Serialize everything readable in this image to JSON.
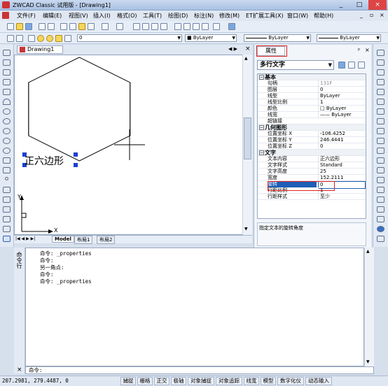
{
  "window": {
    "title": "ZWCAD Classic 试用版 - [Drawing1]",
    "min": "_",
    "restore": "□",
    "close": "×",
    "doc_min": "_",
    "doc_restore": "▫",
    "doc_close": "×"
  },
  "menu": [
    "文件(F)",
    "编辑(E)",
    "视图(V)",
    "插入(I)",
    "格式(O)",
    "工具(T)",
    "绘图(D)",
    "标注(N)",
    "修改(M)",
    "ET扩展工具(X)",
    "窗口(W)",
    "帮助(H)"
  ],
  "toolbar2": {
    "layer_value": "0",
    "color_value": "■ ByLayer",
    "linetype_value": "ByLayer",
    "lineweight_value": "ByLayer"
  },
  "drawing": {
    "tab_label": "Drawing1",
    "text_entity": "正六边形",
    "ucs_y": "Y",
    "ucs_x": "X",
    "layout_tabs": [
      "Model",
      "布局1",
      "布局2"
    ]
  },
  "properties": {
    "tab_label": "属性",
    "object_type": "多行文字",
    "categories": {
      "basic": "基本",
      "geometry": "几何图形",
      "text": "文字"
    },
    "basic_rows": [
      {
        "key": "句柄",
        "value": "131F"
      },
      {
        "key": "图层",
        "value": "0"
      },
      {
        "key": "线型",
        "value": "ByLayer"
      },
      {
        "key": "线型比例",
        "value": "1"
      },
      {
        "key": "颜色",
        "value": "□ ByLayer"
      },
      {
        "key": "线宽",
        "value": "—— ByLayer"
      },
      {
        "key": "超链接",
        "value": ""
      }
    ],
    "geometry_rows": [
      {
        "key": "位置坐标 X",
        "value": "-106.4252"
      },
      {
        "key": "位置坐标 Y",
        "value": "246.4441"
      },
      {
        "key": "位置坐标 Z",
        "value": "0"
      }
    ],
    "text_rows": [
      {
        "key": "文本内容",
        "value": "正六边形"
      },
      {
        "key": "文字样式",
        "value": "Standard"
      },
      {
        "key": "文字高度",
        "value": "25"
      },
      {
        "key": "宽度",
        "value": "152.2111"
      },
      {
        "key": "旋转",
        "value": "0"
      },
      {
        "key": "行距比例",
        "value": "1"
      },
      {
        "key": "行距样式",
        "value": "至少"
      }
    ],
    "description": "指定文本的旋转角度"
  },
  "command": {
    "side_label": "命令行",
    "lines": [
      "命令: _properties",
      "命令:",
      "另一角点:",
      "命令:",
      "命令: _properties"
    ],
    "prompt": "命令:"
  },
  "status": {
    "coords": "207.2981, 279.4487, 0",
    "buttons": [
      "捕捉",
      "栅格",
      "正交",
      "极轴",
      "对象捕捉",
      "对象追踪",
      "线宽",
      "模型",
      "数字化仪",
      "动态输入"
    ]
  },
  "colors": {
    "selection": "#1d5fb7",
    "highlight_box": "#e02020",
    "grip": "#1d3fd0"
  }
}
